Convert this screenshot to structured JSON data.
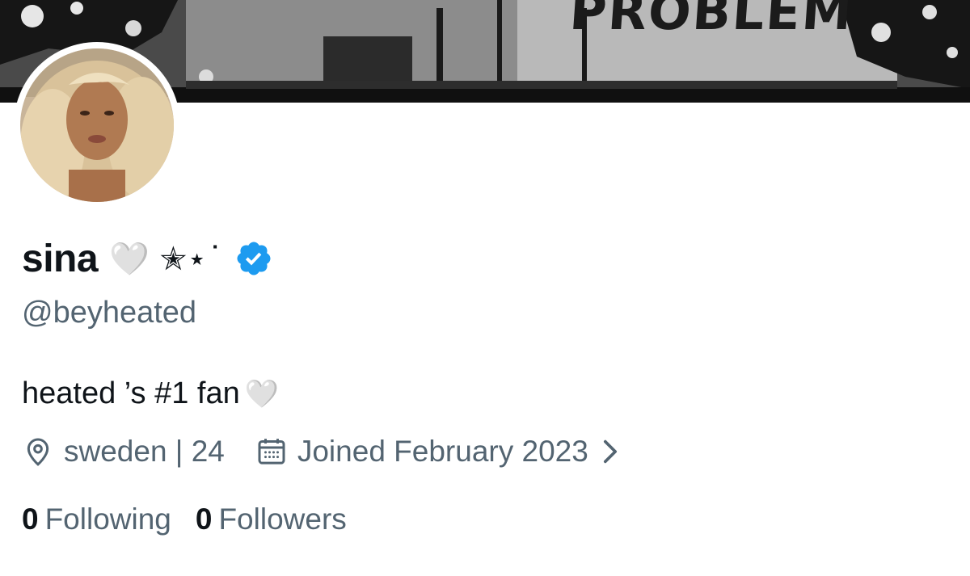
{
  "banner": {
    "text": "PROBLEM"
  },
  "profile": {
    "display_name": "sina",
    "name_emoji": "🤍 ✭⋆˙",
    "verified": true,
    "handle": "@beyheated",
    "bio": "heated ’s #1 fan",
    "bio_emoji": "🤍",
    "location": "sweden | 24",
    "joined": "Joined February 2023"
  },
  "stats": {
    "following_count": "0",
    "following_label": "Following",
    "followers_count": "0",
    "followers_label": "Followers"
  },
  "colors": {
    "text_primary": "#0f1419",
    "text_secondary": "#536471",
    "verified_blue": "#1d9bf0"
  },
  "icons": {
    "location": "location-pin-icon",
    "calendar": "calendar-icon",
    "chevron": "chevron-right-icon",
    "verified": "verified-badge-icon"
  }
}
